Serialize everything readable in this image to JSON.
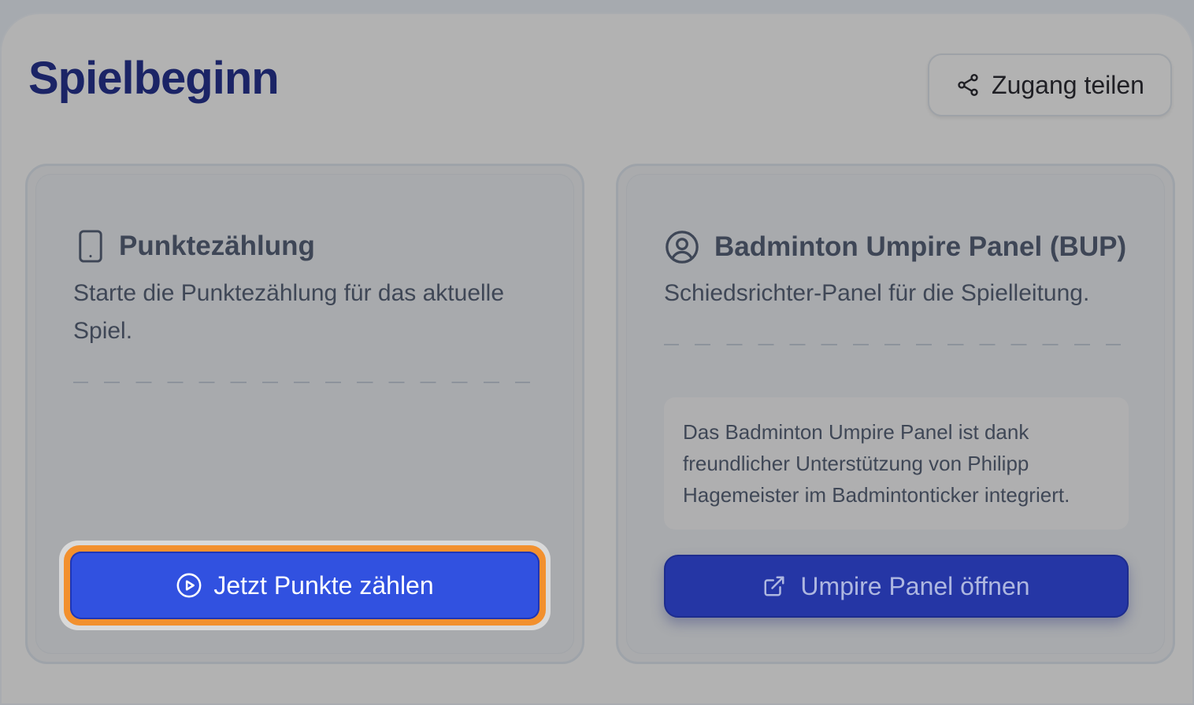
{
  "header": {
    "title": "Spielbeginn",
    "share_label": "Zugang teilen",
    "share_icon": "share-icon"
  },
  "cards": {
    "scoring": {
      "icon": "smartphone-icon",
      "title": "Punktezählung",
      "description": "Starte die Punktezählung für das aktuelle Spiel.",
      "button_label": "Jetzt Punkte zählen",
      "button_icon": "play-circle-icon"
    },
    "umpire": {
      "icon": "user-circle-icon",
      "title": "Badminton Umpire Panel (BUP)",
      "description": "Schiedsrichter-Panel für die Spielleitung.",
      "info": "Das Badminton Umpire Panel ist dank freundlicher Unterstützung von Philipp Hagemeister im Badmintonticker integriert.",
      "button_label": "Umpire Panel öffnen",
      "button_icon": "external-link-icon"
    }
  },
  "colors": {
    "title": "#1b2466",
    "primary_button": "#3151e0",
    "focus_ring": "#f2902e",
    "secondary_button": "#2536a5"
  }
}
